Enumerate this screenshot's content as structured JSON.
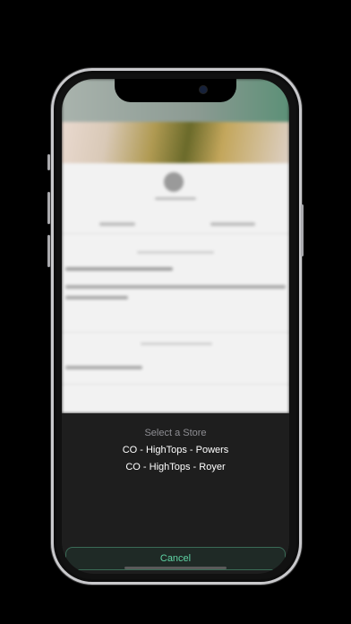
{
  "sheet": {
    "title": "Select a Store",
    "options": [
      {
        "label": "CO - HighTops - Powers"
      },
      {
        "label": "CO - HighTops - Royer"
      }
    ],
    "cancel_label": "Cancel"
  },
  "colors": {
    "accent": "#5fd3a4",
    "sheet_background": "#1e1e1e",
    "title_gray": "#8e8e93"
  }
}
